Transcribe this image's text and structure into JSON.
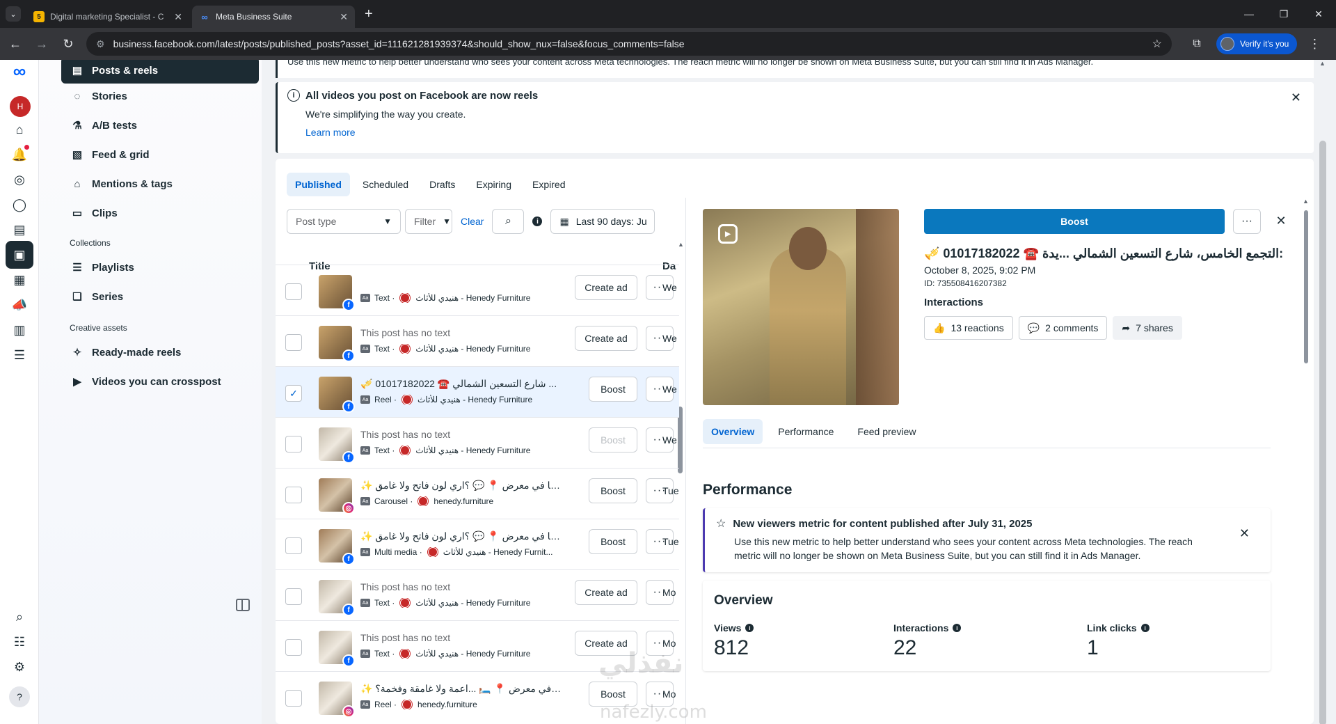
{
  "browser": {
    "tabs": [
      {
        "title": "Digital marketing Specialist - C",
        "favicon": "5",
        "active": false
      },
      {
        "title": "Meta Business Suite",
        "favicon": "∞",
        "active": true
      }
    ],
    "url": "business.facebook.com/latest/posts/published_posts?asset_id=111621281939374&should_show_nux=false&focus_comments=false",
    "verify_label": "Verify it's you"
  },
  "sidebar": {
    "items": [
      {
        "label": "Posts & reels",
        "icon": "posts-icon"
      },
      {
        "label": "Stories",
        "icon": "stories-icon"
      },
      {
        "label": "A/B tests",
        "icon": "flask-icon"
      },
      {
        "label": "Feed & grid",
        "icon": "grid-icon"
      },
      {
        "label": "Mentions & tags",
        "icon": "tag-icon"
      },
      {
        "label": "Clips",
        "icon": "clip-icon"
      }
    ],
    "collections_label": "Collections",
    "collections": [
      {
        "label": "Playlists",
        "icon": "playlist-icon"
      },
      {
        "label": "Series",
        "icon": "series-icon"
      }
    ],
    "creative_label": "Creative assets",
    "creative": [
      {
        "label": "Ready-made reels",
        "icon": "magic-icon"
      },
      {
        "label": "Videos you can crosspost",
        "icon": "video-icon"
      }
    ]
  },
  "banners": {
    "top_strip": "Use this new metric to help better understand who sees your content across Meta technologies. The reach metric will no longer be shown on Meta Business Suite, but you can still find it in Ads Manager.",
    "notice_title": "All videos you post on Facebook are now reels",
    "notice_body": "We're simplifying the way you create.",
    "notice_link": "Learn more"
  },
  "tabs": [
    "Published",
    "Scheduled",
    "Drafts",
    "Expiring",
    "Expired"
  ],
  "filters": {
    "post_type": "Post type",
    "filter": "Filter",
    "clear": "Clear",
    "date_range": "Last 90 days: Ju"
  },
  "columns": {
    "title": "Title",
    "date": "Da"
  },
  "rows": [
    {
      "title": "",
      "type": "Text ·",
      "page": "هنيدي للأثاث - Henedy Furniture",
      "action": "Create ad",
      "date": "We",
      "platform": "fb",
      "selected": false,
      "thumb": "person"
    },
    {
      "title": "This post has no text",
      "type": "Text ·",
      "page": "هنيدي للأثاث - Henedy Furniture",
      "action": "Create ad",
      "date": "We",
      "platform": "fb",
      "selected": false,
      "thumb": "person"
    },
    {
      "title": "🎺 01017182022 ☎️ شارع التسعين الشمالي ...",
      "type": "Reel ·",
      "page": "هنيدي للأثاث - Henedy Furniture",
      "action": "Boost",
      "date": "We",
      "platform": "fb",
      "selected": true,
      "thumb": "person"
    },
    {
      "title": "This post has no text",
      "type": "Text ·",
      "page": "هنيدي للأثاث - Henedy Furniture",
      "action": "Boost",
      "date": "We",
      "platform": "fb",
      "selected": false,
      "thumb": "light",
      "disabled": true
    },
    {
      "title": "✨ زورنا في معرض 📍 💬 ؟اري لون فاتح ولا غامق...",
      "type": "Carousel ·",
      "page": "henedy.furniture",
      "action": "Boost",
      "date": "Tue",
      "platform": "ig",
      "selected": false,
      "thumb": "room"
    },
    {
      "title": "✨ زورنا في معرض 📍 💬 ؟اري لون فاتح ولا غامق...",
      "type": "Multi media ·",
      "page": "هنيدي للأثاث - Henedy Furnit...",
      "action": "Boost",
      "date": "Tue",
      "platform": "fb",
      "selected": false,
      "thumb": "room"
    },
    {
      "title": "This post has no text",
      "type": "Text ·",
      "page": "هنيدي للأثاث - Henedy Furniture",
      "action": "Create ad",
      "date": "Mo",
      "platform": "fb",
      "selected": false,
      "thumb": "light"
    },
    {
      "title": "This post has no text",
      "type": "Text ·",
      "page": "هنيدي للأثاث - Henedy Furniture",
      "action": "Create ad",
      "date": "Mo",
      "platform": "fb",
      "selected": false,
      "thumb": "light"
    },
    {
      "title": "✨ زورنا في معرض 📍 🛏️ ...اعمة ولا غامقة وفخمة؟",
      "type": "Reel ·",
      "page": "henedy.furniture",
      "action": "Boost",
      "date": "Mo",
      "platform": "ig",
      "selected": false,
      "thumb": "light"
    }
  ],
  "detail": {
    "boost_label": "Boost",
    "title": "🎺 01017182022 ☎️ التجمع الخامس، شارع التسعين الشمالي ...يدة:",
    "date": "October 8, 2025, 9:02 PM",
    "id": "ID: 735508416207382",
    "interactions_label": "Interactions",
    "chips": [
      {
        "label": "13 reactions",
        "icon": "like-icon"
      },
      {
        "label": "2 comments",
        "icon": "comment-icon"
      },
      {
        "label": "7 shares",
        "icon": "share-icon"
      }
    ],
    "tabs": [
      "Overview",
      "Performance",
      "Feed preview"
    ],
    "performance_title": "Performance",
    "new_viewers_title": "New viewers metric for content published after July 31, 2025",
    "new_viewers_body": "Use this new metric to help better understand who sees your content across Meta technologies. The reach metric will no longer be shown on Meta Business Suite, but you can still find it in Ads Manager.",
    "overview_title": "Overview",
    "kpis": [
      {
        "label": "Views",
        "value": "812"
      },
      {
        "label": "Interactions",
        "value": "22"
      },
      {
        "label": "Link clicks",
        "value": "1"
      }
    ]
  },
  "watermark": {
    "arabic": "نفذلي",
    "latin": "nafezly.com"
  }
}
